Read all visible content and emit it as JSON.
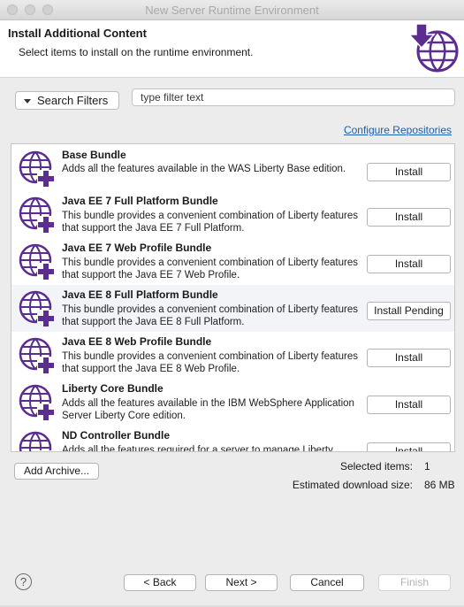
{
  "window": {
    "title": "New Server Runtime Environment"
  },
  "header": {
    "title": "Install Additional Content",
    "description": "Select items to install on the runtime environment."
  },
  "filters": {
    "button_label": "Search Filters",
    "search_placeholder": "type filter text"
  },
  "configure_link": "Configure Repositories",
  "bundles": [
    {
      "name": "Base Bundle",
      "desc": "Adds all the features available in the WAS Liberty Base edition.",
      "action": "Install"
    },
    {
      "name": "Java EE 7 Full Platform Bundle",
      "desc": "This bundle provides a convenient combination of Liberty features that support the Java EE 7 Full Platform.",
      "action": "Install"
    },
    {
      "name": "Java EE 7 Web Profile Bundle",
      "desc": "This bundle provides a convenient combination of Liberty features that support the Java EE 7 Web Profile.",
      "action": "Install"
    },
    {
      "name": "Java EE 8 Full Platform Bundle",
      "desc": "This bundle provides a convenient combination of Liberty features that support the Java EE 8 Full Platform.",
      "action": "Install Pending"
    },
    {
      "name": "Java EE 8 Web Profile Bundle",
      "desc": "This bundle provides a convenient combination of Liberty features that support the Java EE 8 Web Profile.",
      "action": "Install"
    },
    {
      "name": "Liberty Core Bundle",
      "desc": "Adds all the features available in the IBM WebSphere Application Server Liberty Core edition.",
      "action": "Install"
    },
    {
      "name": "ND Controller Bundle",
      "desc": "Adds all the features required for a server to manage Liberty",
      "action": "Install"
    }
  ],
  "add_archive_label": "Add Archive...",
  "stats": {
    "selected_label": "Selected items:",
    "selected_value": "1",
    "download_label": "Estimated download size:",
    "download_value": "86 MB"
  },
  "footer": {
    "help_glyph": "?",
    "back_label": "< Back",
    "next_label": "Next >",
    "cancel_label": "Cancel",
    "finish_label": "Finish"
  },
  "colors": {
    "accent_purple": "#5b2d8e",
    "link_blue": "#1a5fb0",
    "highlight_row": "#f2f4f8"
  }
}
